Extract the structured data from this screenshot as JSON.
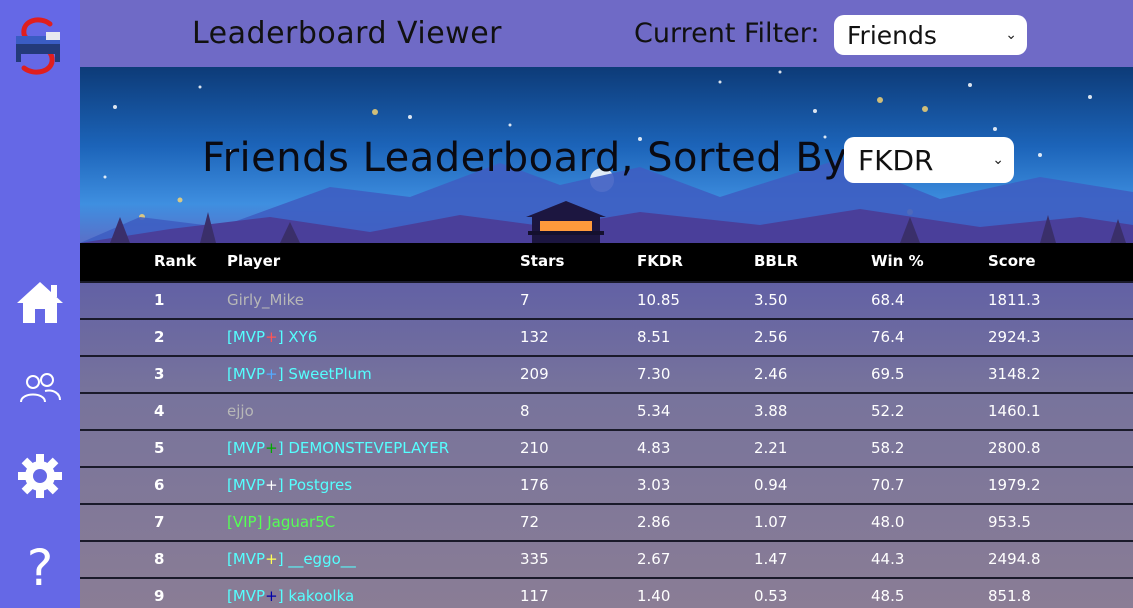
{
  "header": {
    "title": "Leaderboard Viewer",
    "filter_label": "Current Filter:",
    "filter_value": "Friends"
  },
  "banner": {
    "title": "Friends Leaderboard, Sorted By",
    "sort_value": "FKDR"
  },
  "sidebar": {
    "items": [
      {
        "name": "home",
        "icon": "home-icon"
      },
      {
        "name": "friends",
        "icon": "users-icon"
      },
      {
        "name": "settings",
        "icon": "gear-icon"
      },
      {
        "name": "help",
        "icon": "question-icon"
      }
    ]
  },
  "table": {
    "columns": [
      "Rank",
      "Player",
      "Stars",
      "FKDR",
      "BBLR",
      "Win %",
      "Score"
    ],
    "rows": [
      {
        "rank": "1",
        "rank_tag": "",
        "plus": "",
        "close": "",
        "name": "Girly_Mike",
        "color": "#b7b7b7",
        "plus_color": "",
        "stars": "7",
        "fkdr": "10.85",
        "bblr": "3.50",
        "win": "68.4",
        "score": "1811.3"
      },
      {
        "rank": "2",
        "rank_tag": "[MVP",
        "plus": "+",
        "close": "] ",
        "name": "XY6",
        "color": "#55ffff",
        "plus_color": "#ff5555",
        "stars": "132",
        "fkdr": "8.51",
        "bblr": "2.56",
        "win": "76.4",
        "score": "2924.3"
      },
      {
        "rank": "3",
        "rank_tag": "[MVP",
        "plus": "+",
        "close": "] ",
        "name": "SweetPlum",
        "color": "#55ffff",
        "plus_color": "#55aaff",
        "stars": "209",
        "fkdr": "7.30",
        "bblr": "2.46",
        "win": "69.5",
        "score": "3148.2"
      },
      {
        "rank": "4",
        "rank_tag": "",
        "plus": "",
        "close": "",
        "name": "ejjo",
        "color": "#b7b7b7",
        "plus_color": "",
        "stars": "8",
        "fkdr": "5.34",
        "bblr": "3.88",
        "win": "52.2",
        "score": "1460.1"
      },
      {
        "rank": "5",
        "rank_tag": "[MVP",
        "plus": "+",
        "close": "] ",
        "name": "DEMONSTEVEPLAYER",
        "color": "#55ffff",
        "plus_color": "#00aa00",
        "stars": "210",
        "fkdr": "4.83",
        "bblr": "2.21",
        "win": "58.2",
        "score": "2800.8"
      },
      {
        "rank": "6",
        "rank_tag": "[MVP",
        "plus": "+",
        "close": "] ",
        "name": "Postgres",
        "color": "#55ffff",
        "plus_color": "#ffffff",
        "stars": "176",
        "fkdr": "3.03",
        "bblr": "0.94",
        "win": "70.7",
        "score": "1979.2"
      },
      {
        "rank": "7",
        "rank_tag": "[VIP",
        "plus": "",
        "close": "] ",
        "name": "Jaguar5C",
        "color": "#55ff55",
        "plus_color": "",
        "stars": "72",
        "fkdr": "2.86",
        "bblr": "1.07",
        "win": "48.0",
        "score": "953.5"
      },
      {
        "rank": "8",
        "rank_tag": "[MVP",
        "plus": "+",
        "close": "] ",
        "name": "__eggo__",
        "color": "#55ffff",
        "plus_color": "#ffff55",
        "stars": "335",
        "fkdr": "2.67",
        "bblr": "1.47",
        "win": "44.3",
        "score": "2494.8"
      },
      {
        "rank": "9",
        "rank_tag": "[MVP",
        "plus": "+",
        "close": "] ",
        "name": "kakoolka",
        "color": "#55ffff",
        "plus_color": "#0000aa",
        "stars": "117",
        "fkdr": "1.40",
        "bblr": "0.53",
        "win": "48.5",
        "score": "851.8"
      }
    ]
  }
}
